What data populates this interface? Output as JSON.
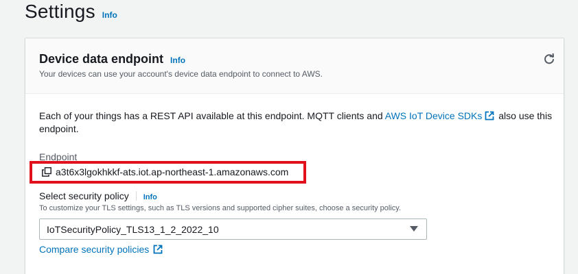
{
  "header": {
    "title": "Settings",
    "info": "Info"
  },
  "panel": {
    "title": "Device data endpoint",
    "info": "Info",
    "description": "Your devices can use your account's device data endpoint to connect to AWS.",
    "refresh_icon": "refresh-icon",
    "body_text_before": "Each of your things has a REST API available at this endpoint. MQTT clients and ",
    "body_link": "AWS IoT Device SDKs",
    "body_text_after": " also use this endpoint.",
    "endpoint_label": "Endpoint",
    "endpoint_value": "a3t6x3lgokhkkf-ats.iot.ap-northeast-1.amazonaws.com",
    "copy_icon": "copy-icon",
    "policy_label": "Select security policy",
    "policy_info": "Info",
    "policy_description": "To customize your TLS settings, such as TLS versions and supported cipher suites, choose a security policy.",
    "policy_selected": "IoTSecurityPolicy_TLS13_1_2_2022_10",
    "compare_link": "Compare security policies"
  },
  "colors": {
    "link": "#0073bb",
    "highlight_border": "#e0111c",
    "background": "#f2f3f3"
  }
}
